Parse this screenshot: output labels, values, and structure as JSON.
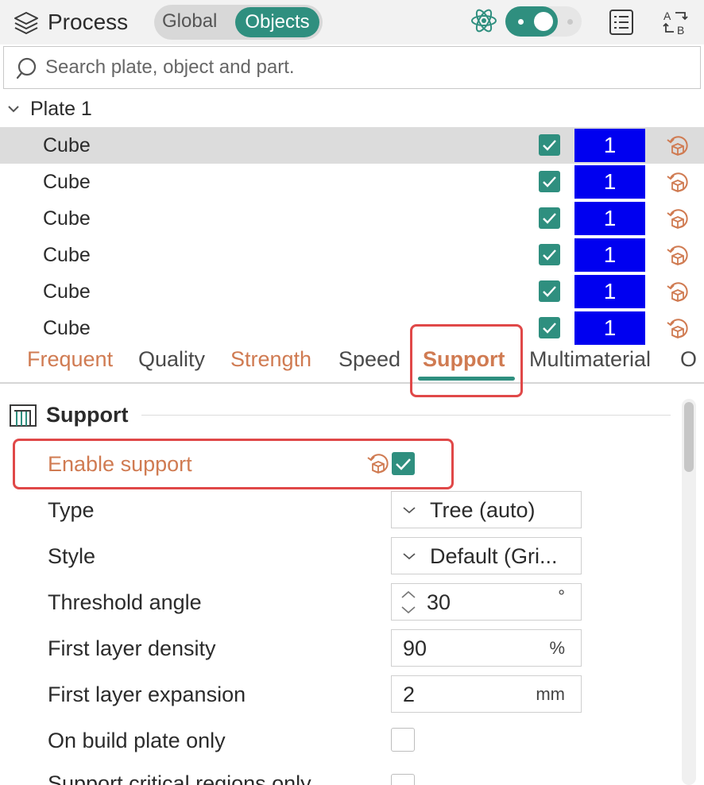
{
  "header": {
    "title": "Process",
    "segment": {
      "global_label": "Global",
      "objects_label": "Objects",
      "selected": "Objects"
    },
    "toggle_on": true
  },
  "search": {
    "placeholder": "Search plate, object and part."
  },
  "tree": {
    "plate_label": "Plate 1",
    "rows": [
      {
        "label": "Cube",
        "checked": true,
        "extruder": "1",
        "selected": true
      },
      {
        "label": "Cube",
        "checked": true,
        "extruder": "1",
        "selected": false
      },
      {
        "label": "Cube",
        "checked": true,
        "extruder": "1",
        "selected": false
      },
      {
        "label": "Cube",
        "checked": true,
        "extruder": "1",
        "selected": false
      },
      {
        "label": "Cube",
        "checked": true,
        "extruder": "1",
        "selected": false
      },
      {
        "label": "Cube",
        "checked": true,
        "extruder": "1",
        "selected": false
      }
    ]
  },
  "tabs": [
    {
      "label": "Frequent",
      "state": "modified"
    },
    {
      "label": "Quality",
      "state": "normal"
    },
    {
      "label": "Strength",
      "state": "modified"
    },
    {
      "label": "Speed",
      "state": "normal"
    },
    {
      "label": "Support",
      "state": "active"
    },
    {
      "label": "Multimaterial",
      "state": "normal"
    },
    {
      "label": "O",
      "state": "normal"
    }
  ],
  "section": {
    "title": "Support",
    "options": {
      "enable_support": {
        "label": "Enable support",
        "checked": true
      },
      "type": {
        "label": "Type",
        "value": "Tree (auto)"
      },
      "style": {
        "label": "Style",
        "value": "Default (Gri..."
      },
      "threshold_angle": {
        "label": "Threshold angle",
        "value": "30",
        "unit": "°"
      },
      "first_layer_density": {
        "label": "First layer density",
        "value": "90",
        "unit": "%"
      },
      "first_layer_expansion": {
        "label": "First layer expansion",
        "value": "2",
        "unit": "mm"
      },
      "on_build_plate_only": {
        "label": "On build plate only",
        "checked": false
      },
      "support_critical_regions_only": {
        "label": "Support critical regions only",
        "checked": false
      }
    }
  },
  "colors": {
    "accent": "#2f8f7f",
    "modified": "#d07b52",
    "extruder_bg": "#0000f0",
    "highlight_box": "#e04848",
    "selected_row": "#dcdcdc"
  },
  "icons": {
    "header": [
      "process-layers-icon",
      "atom-icon",
      "list-icon",
      "ab-swap-icon"
    ],
    "search": "search-icon",
    "row_reset": "reset-cube-icon",
    "section": "support-section-icon"
  }
}
